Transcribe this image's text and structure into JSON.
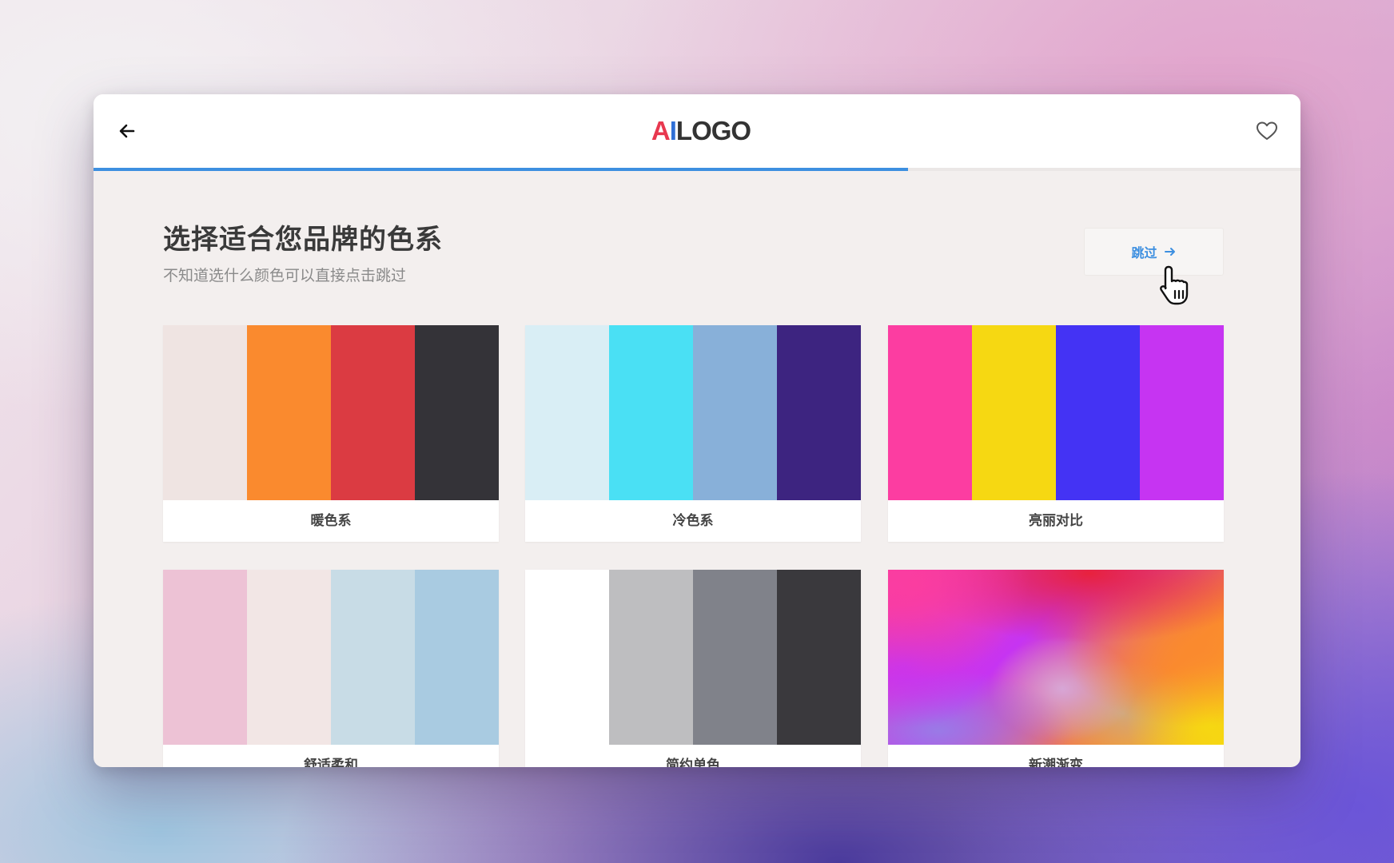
{
  "header": {
    "back_icon": "arrow-left-icon",
    "logo": {
      "part_a": "A",
      "part_i": "I",
      "part_rest": "LOGO"
    },
    "favorite_icon": "heart-outline-icon"
  },
  "progress": {
    "value": 0.675,
    "color": "#3d8fe0"
  },
  "main": {
    "title": "选择适合您品牌的色系",
    "subtitle": "不知道选什么颜色可以直接点击跳过",
    "skip_button": {
      "label": "跳过",
      "icon": "arrow-right-icon"
    }
  },
  "palettes": [
    {
      "name": "暖色系",
      "colors": [
        "#efe4e2",
        "#fa8a2e",
        "#db3b42",
        "#343338"
      ]
    },
    {
      "name": "冷色系",
      "colors": [
        "#d9eef5",
        "#4ae0f4",
        "#88b0d9",
        "#3d2480"
      ]
    },
    {
      "name": "亮丽对比",
      "colors": [
        "#fc3da1",
        "#f6d812",
        "#4433f4",
        "#c634f2"
      ]
    },
    {
      "name": "舒适柔和",
      "colors": [
        "#edc2d5",
        "#f2e6e5",
        "#c8dce6",
        "#a9cbe1"
      ]
    },
    {
      "name": "简约单色",
      "colors": [
        "#ffffff",
        "#bebec0",
        "#80828a",
        "#3a393d"
      ]
    },
    {
      "name": "新潮渐变",
      "gradient": true,
      "colors": [
        "#fb3da0",
        "#e8223d",
        "#fa8a2e",
        "#f6d812",
        "#c634f2",
        "#9a7ae6",
        "#d7a6d6",
        "#d2a97a"
      ]
    }
  ],
  "cursor_icon": "hand-pointer-cursor-icon"
}
